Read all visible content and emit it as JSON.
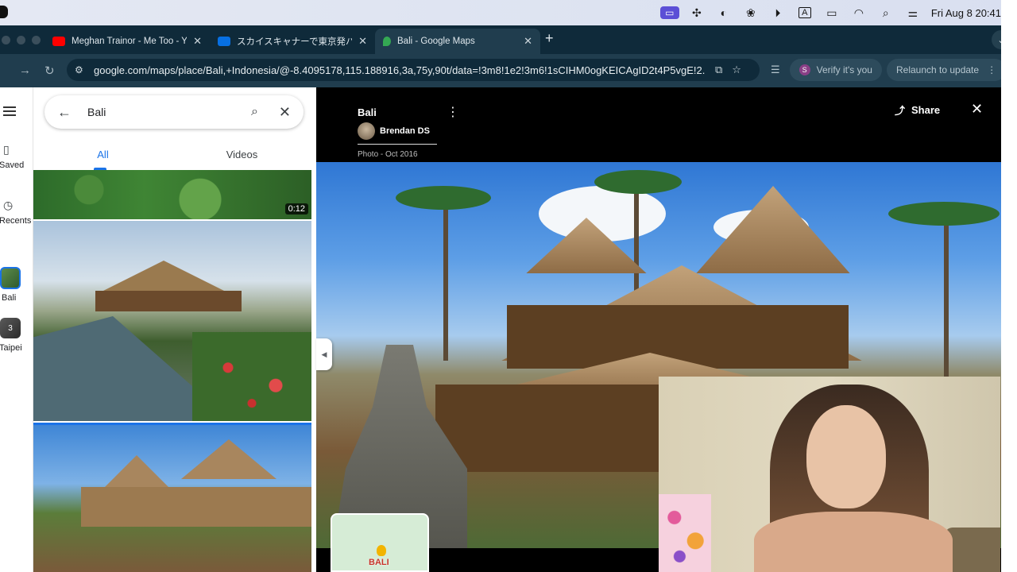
{
  "menubar": {
    "clock": "Fri Aug 8  20:41",
    "icons": [
      "screen-share-icon",
      "teams-icon",
      "contrast-icon",
      "colorsync-icon",
      "play-icon",
      "keyboard-input-icon",
      "battery-icon",
      "wifi-icon",
      "search-icon",
      "control-center-icon"
    ],
    "input_label": "A"
  },
  "browser": {
    "tabs": [
      {
        "title": "Meghan Trainor - Me Too - Yo",
        "favicon_color": "#ff0000"
      },
      {
        "title": "スカイスキャナーで東京発バンコク",
        "favicon_color": "#0770e3"
      },
      {
        "title": "Bali - Google Maps",
        "favicon_color": "#34a853",
        "active": true
      }
    ],
    "url": "google.com/maps/place/Bali,+Indonesia/@-8.4095178,115.188916,3a,75y,90t/data=!3m8!1e2!3m6!1sCIHM0ogKEICAgID2t4P5vgE!2...",
    "verify_label": "Verify it's you",
    "verify_avatar": "S",
    "relaunch_label": "Relaunch to update"
  },
  "rail": {
    "saved_label": "Saved",
    "recents_label": "Recents",
    "bali_label": "Bali",
    "taipei_label": "Taipei",
    "taipei_badge": "3"
  },
  "panel": {
    "search_value": "Bali",
    "tabs": [
      "All",
      "Videos"
    ],
    "video_duration": "0:12"
  },
  "viewer": {
    "title": "Bali",
    "author": "Brendan DS",
    "meta": "Photo - Oct 2016",
    "share_label": "Share",
    "minimap_label": "BALI"
  },
  "colors": {
    "accent": "#1a73e8",
    "chrome_dark": "#0f2a3a",
    "chrome_toolbar": "#203d4e",
    "viewer_bg": "#000000"
  }
}
